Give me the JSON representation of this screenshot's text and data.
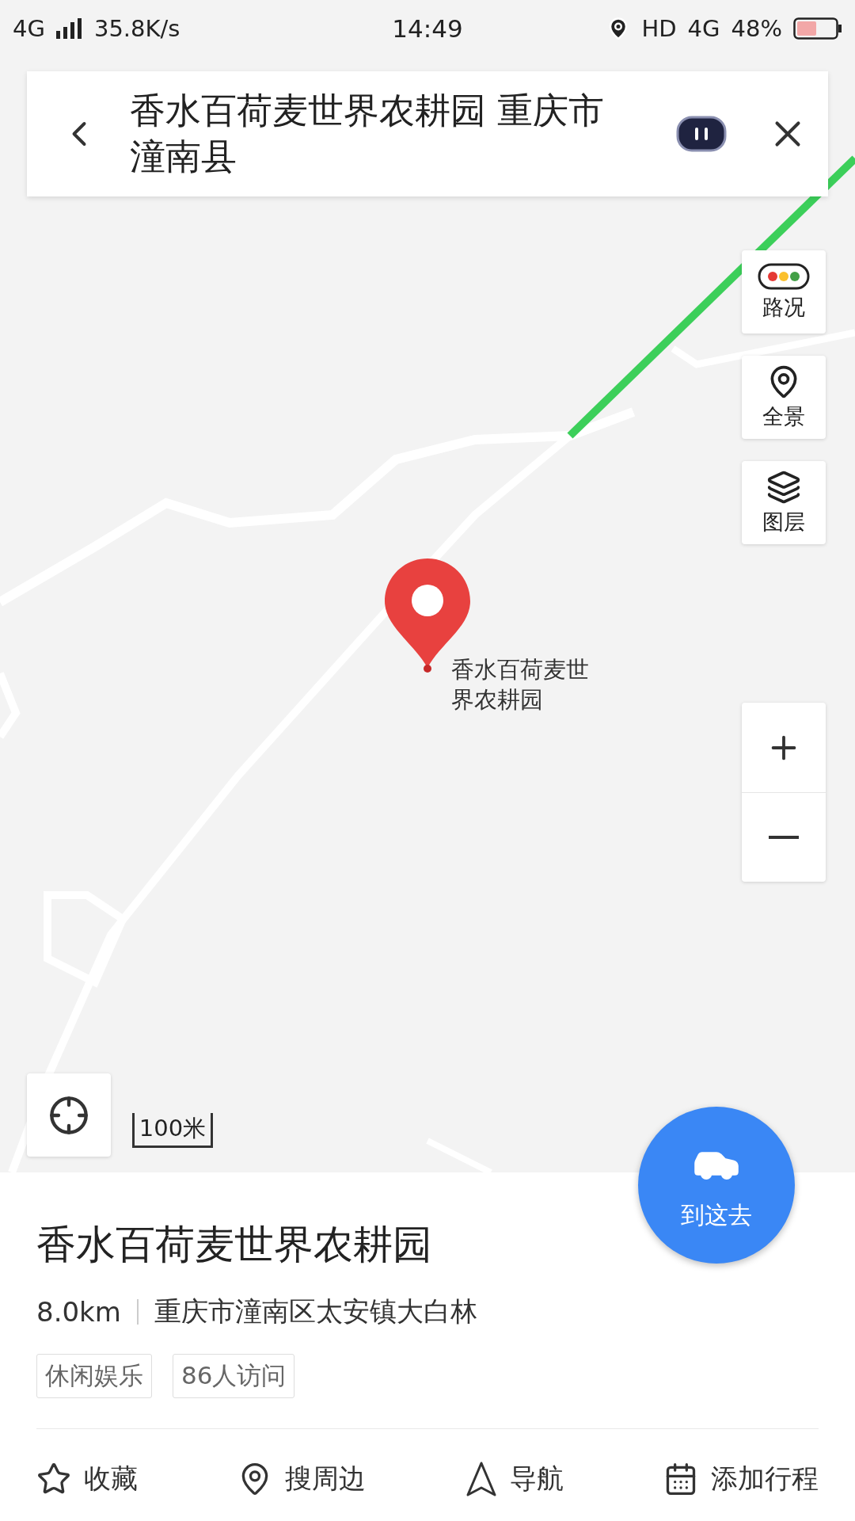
{
  "status_bar": {
    "network": "4G",
    "speed": "35.8K/s",
    "time": "14:49",
    "hd": "HD",
    "network_right": "4G",
    "battery": "48%"
  },
  "search": {
    "query": "香水百荷麦世界农耕园 重庆市潼南县"
  },
  "map": {
    "kind": "picture",
    "marker": {
      "label": "香水百荷麦世界农耕园"
    },
    "scale": "100米",
    "controls": [
      {
        "label": "路况",
        "kind": "traffic"
      },
      {
        "label": "全景",
        "kind": "panorama"
      },
      {
        "label": "图层",
        "kind": "layers"
      }
    ]
  },
  "go_button": {
    "label": "到这去"
  },
  "place": {
    "name": "香水百荷麦世界农耕园",
    "distance": "8.0km",
    "address": "重庆市潼南区太安镇大白林",
    "tags": [
      "休闲娱乐",
      "86人访问"
    ]
  },
  "actions": [
    {
      "label": "收藏",
      "kind": "favorite"
    },
    {
      "label": "搜周边",
      "kind": "nearby"
    },
    {
      "label": "导航",
      "kind": "navigate"
    },
    {
      "label": "添加行程",
      "kind": "schedule"
    }
  ]
}
